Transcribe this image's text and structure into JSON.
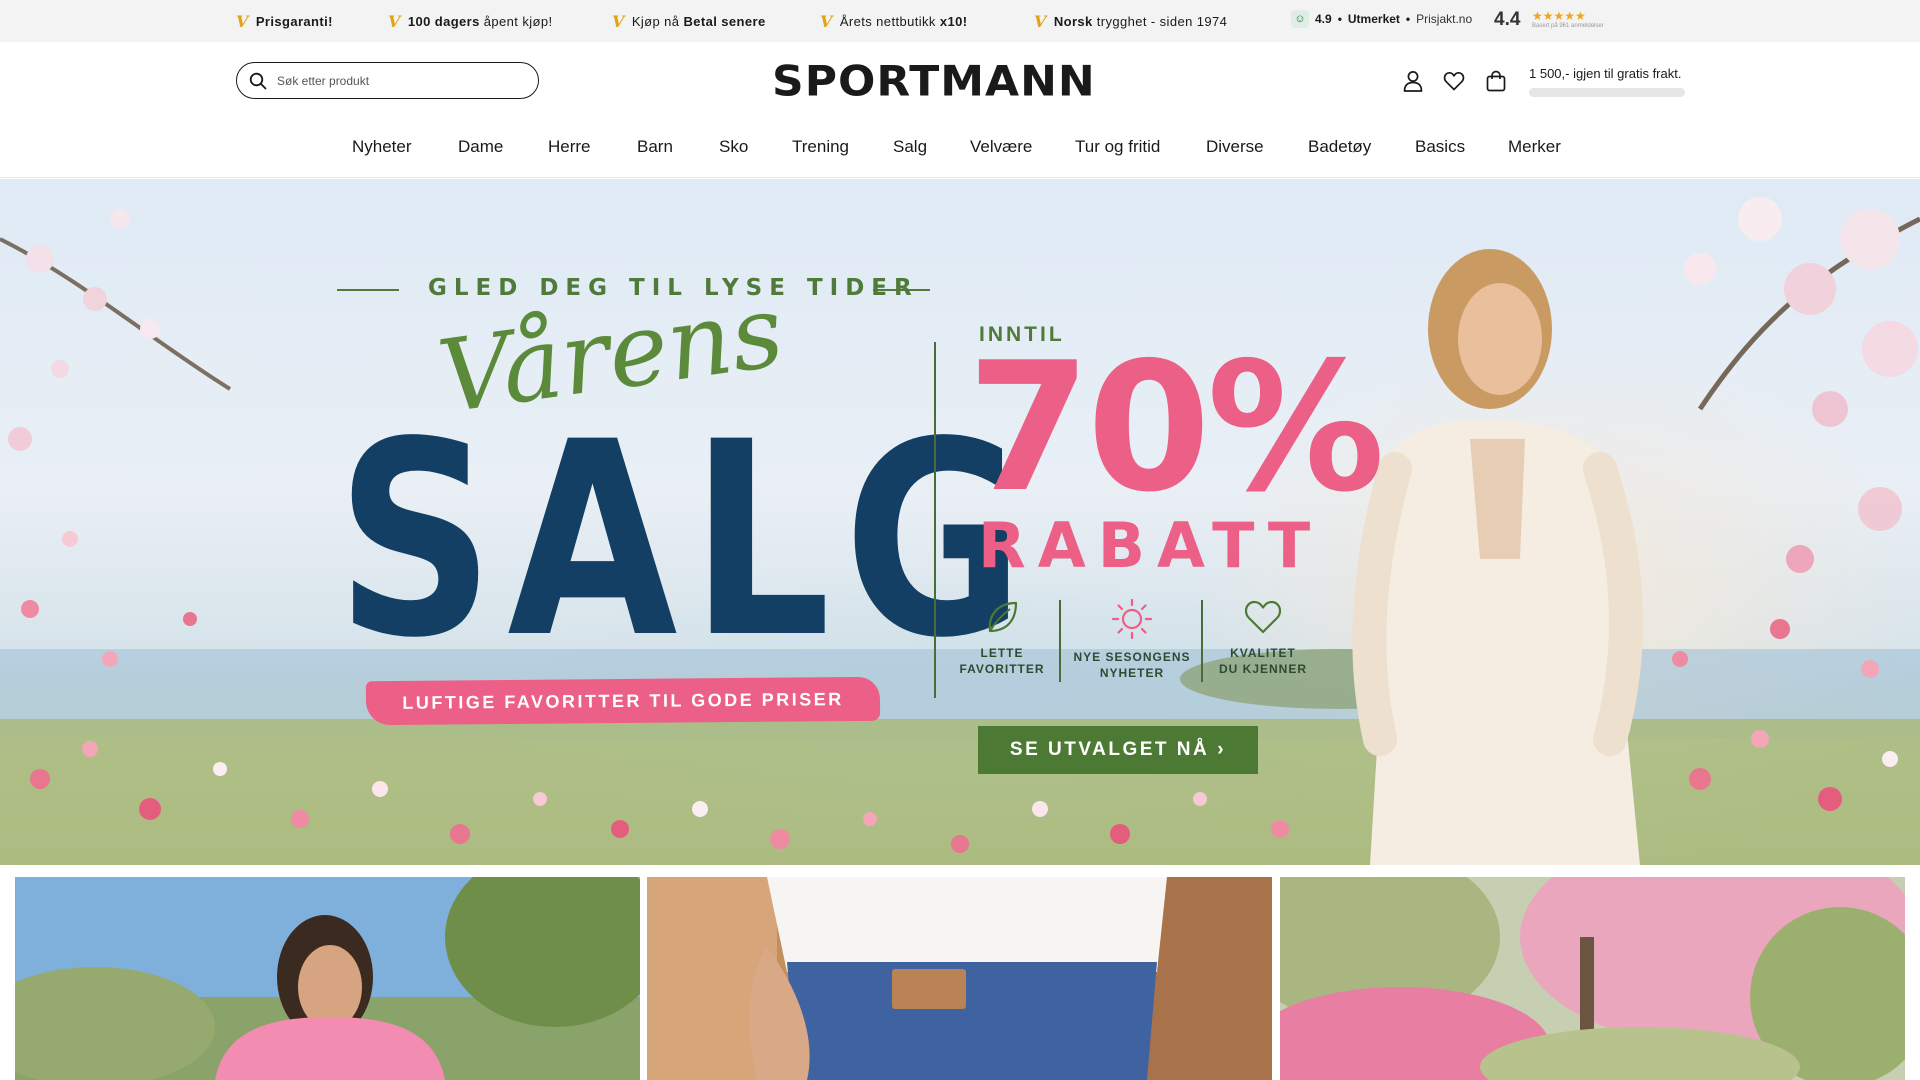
{
  "usp_bar": {
    "items": [
      {
        "text_pre": "",
        "text_bold": "Prisgaranti!",
        "text_post": ""
      },
      {
        "text_pre": "",
        "text_bold": "100 dagers",
        "text_post": " åpent kjøp!"
      },
      {
        "text_pre": "Kjøp nå ",
        "text_bold": "Betal senere",
        "text_post": ""
      },
      {
        "text_pre": "Årets nettbutikk ",
        "text_bold": "x10!",
        "text_post": ""
      },
      {
        "text_pre": "",
        "text_bold": "Norsk",
        "text_post": " trygghet - siden 1974"
      }
    ],
    "check_glyph": "V",
    "rating": {
      "score": "4.9",
      "separator": "•",
      "label": "Utmerket",
      "source": "Prisjakt.no"
    },
    "prisjakt_score": "4.4",
    "prisjakt_stars": "★★★★★",
    "prisjakt_basis": "Basert på 961 anmeldelser",
    "check_color": "#e1a21a"
  },
  "header": {
    "search_placeholder": "Søk etter produkt",
    "logo_text": "SPORTMANN",
    "icons": [
      "user-icon",
      "heart-icon",
      "bag-icon"
    ],
    "freight_text": "1 500,- igjen til gratis frakt.",
    "freight_progress": 0
  },
  "nav": {
    "items": [
      "Nyheter",
      "Dame",
      "Herre",
      "Barn",
      "Sko",
      "Trening",
      "Salg",
      "Velvære",
      "Tur og fritid",
      "Diverse",
      "Badetøy",
      "Basics",
      "Merker"
    ]
  },
  "hero": {
    "tagline": "GLED DEG TIL LYSE TIDER",
    "script_title": "Vårens",
    "main_title": "SALG",
    "ribbon_text": "LUFTIGE FAVORITTER TIL GODE PRISER",
    "inntil": "INNTIL",
    "percent": "70%",
    "rabatt": "RABATT",
    "features": [
      {
        "label": "LETTE\nFAVORITTER",
        "icon": "leaf-icon"
      },
      {
        "label": "NYE SESONGENS\nNYHETER",
        "icon": "sun-icon"
      },
      {
        "label": "KVALITET\nDU KJENNER",
        "icon": "heart-icon"
      }
    ],
    "cta_label": "SE UTVALGET NÅ",
    "cta_arrow": "›",
    "colors": {
      "navy": "#123f63",
      "pink": "#ec5f86",
      "green": "#4c7a34"
    }
  },
  "tiles": [
    {
      "name": "woman-pink-blouse"
    },
    {
      "name": "man-denim-jeans"
    },
    {
      "name": "pink-blossom-garden"
    }
  ]
}
